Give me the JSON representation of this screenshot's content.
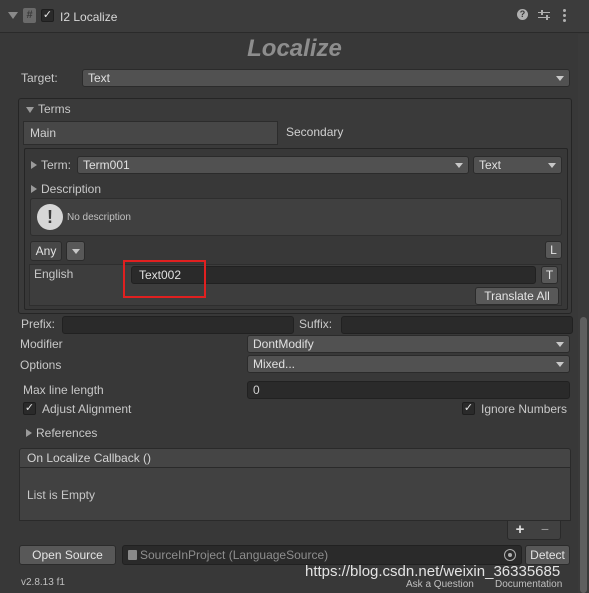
{
  "header": {
    "component_title": "I2 Localize",
    "hash_icon_glyph": "#",
    "check_glyph": "✓"
  },
  "logo": "Localize",
  "target": {
    "label": "Target:",
    "value": "Text"
  },
  "terms": {
    "header": "Terms",
    "tab_main": "Main",
    "tab_secondary": "Secondary",
    "term_label": "Term:",
    "term_value": "Term001",
    "term_type": "Text",
    "description_label": "Description",
    "description_text": "No description",
    "any_label": "Any",
    "l_button": "L",
    "language": "English",
    "translation_value": "Text002",
    "t_button": "T",
    "translate_all": "Translate All"
  },
  "prefix_label": "Prefix:",
  "suffix_label": "Suffix:",
  "modifier": {
    "label": "Modifier",
    "value": "DontModify"
  },
  "options": {
    "label": "Options",
    "value": "Mixed..."
  },
  "max_line_length": {
    "label": "Max line length",
    "value": "0"
  },
  "adjust_alignment": "Adjust Alignment",
  "ignore_numbers": "Ignore Numbers",
  "references": "References",
  "callback": {
    "header": "On Localize Callback ()",
    "empty": "List is Empty",
    "plus": "+",
    "minus": "−"
  },
  "footer": {
    "open_source": "Open Source",
    "source_value": "SourceInProject (LanguageSource)",
    "detect": "Detect",
    "version": "v2.8.13 f1",
    "ask_question": "Ask a Question",
    "documentation": "Documentation",
    "watermark": "https://blog.csdn.net/weixin_36335685"
  },
  "colors": {
    "highlight_box": "#e02020",
    "background": "#383838"
  }
}
